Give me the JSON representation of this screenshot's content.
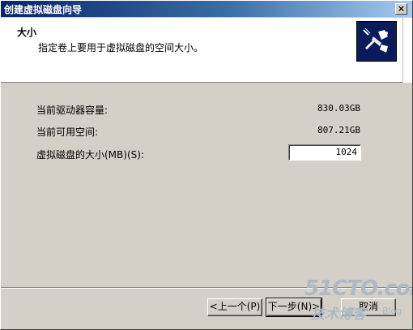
{
  "window": {
    "title": "创建虚拟磁盘向导",
    "close_glyph": "×"
  },
  "header": {
    "title": "大小",
    "subtitle": "指定卷上要用于虚拟磁盘的空间大小。"
  },
  "fields": {
    "capacity_label": "当前驱动器容量:",
    "capacity_value": "830.03GB",
    "available_label": "当前可用空间:",
    "available_value": "807.21GB",
    "size_label": "虚拟磁盘的大小(MB)(S):",
    "size_value": "1024"
  },
  "buttons": {
    "prev": "<上一个(P)",
    "next": "下一步(N)>",
    "cancel": "取消"
  },
  "watermark": {
    "main": "51CTO.com",
    "sub": "技术博客",
    "blog": "Blog"
  },
  "icons": {
    "wizard": "disk-wizard-icon",
    "close": "close-icon"
  },
  "colors": {
    "title_bar": "#0a246a",
    "dialog_face": "#d4d0c8",
    "icon_bg": "#0a1a5a"
  }
}
